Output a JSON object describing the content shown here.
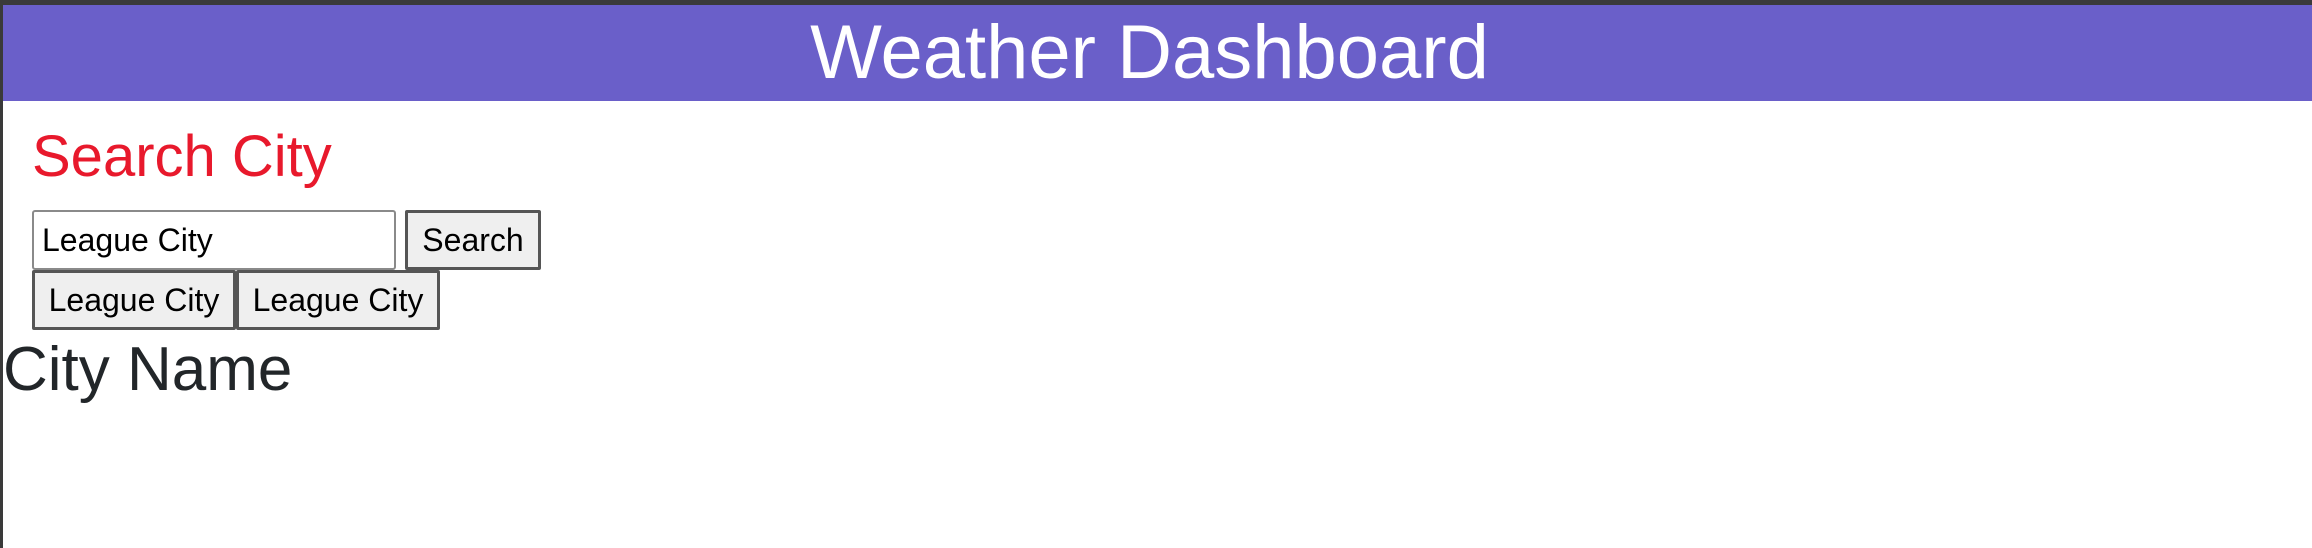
{
  "header": {
    "title": "Weather Dashboard"
  },
  "search": {
    "heading": "Search City",
    "input_value": "League City",
    "button_label": "Search"
  },
  "history": {
    "items": [
      "League City",
      "League City"
    ]
  },
  "result": {
    "city_name": "City Name"
  },
  "colors": {
    "header_bg": "#6a5fc9",
    "heading_red": "#e8192c"
  }
}
